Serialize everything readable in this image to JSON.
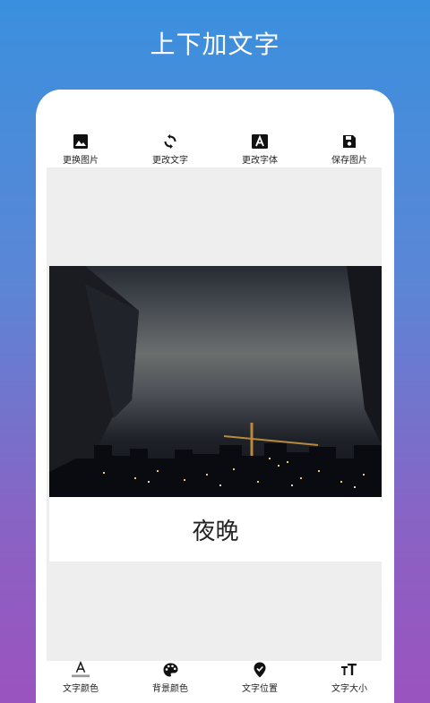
{
  "header": {
    "title": "上下加文字"
  },
  "toolbar": {
    "items": [
      {
        "label": "更换图片",
        "icon": "image-icon"
      },
      {
        "label": "更改文字",
        "icon": "refresh-icon"
      },
      {
        "label": "更改字体",
        "icon": "font-icon"
      },
      {
        "label": "保存图片",
        "icon": "save-icon"
      }
    ]
  },
  "canvas": {
    "caption": "夜晚"
  },
  "bottombar": {
    "items": [
      {
        "label": "文字颜色",
        "icon": "text-color-icon"
      },
      {
        "label": "背景颜色",
        "icon": "palette-icon"
      },
      {
        "label": "文字位置",
        "icon": "location-icon"
      },
      {
        "label": "文字大小",
        "icon": "text-size-icon"
      }
    ]
  },
  "colors": {
    "gradient_top": "#3a90de",
    "gradient_bottom": "#9b53bf",
    "canvas_bg": "#eeeeee"
  }
}
